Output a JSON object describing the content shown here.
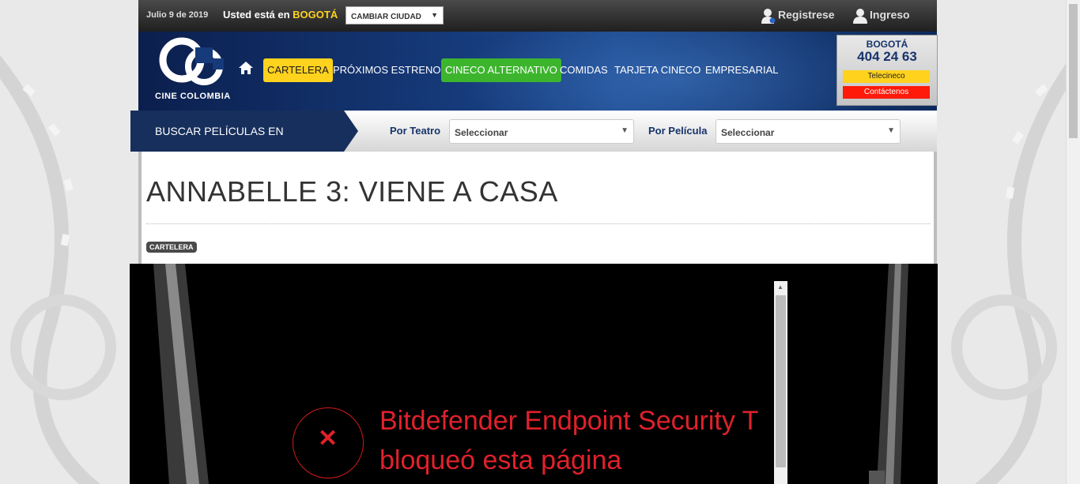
{
  "topbar": {
    "date": "Julio 9 de 2019",
    "location_prefix": "Usted está en",
    "city": "BOGOTÁ",
    "change_city": "CAMBIAR CIUDAD",
    "register": "Registrese",
    "login": "Ingreso"
  },
  "brand": {
    "name": "CINE COLOMBIA"
  },
  "menu": [
    {
      "label": "CARTELERA",
      "style": "yellow"
    },
    {
      "label": "PRÓXIMOS ESTRENOS",
      "style": "plain"
    },
    {
      "label": "CINECO ALTERNATIVO",
      "style": "green"
    },
    {
      "label": "COMIDAS",
      "style": "plain"
    },
    {
      "label": "TARJETA CINECO",
      "style": "plain"
    },
    {
      "label": "EMPRESARIAL",
      "style": "plain"
    }
  ],
  "contact": {
    "city": "BOGOTÁ",
    "phone": "404 24 63",
    "telecineco": "Telecineco",
    "contact_us": "Contáctenos"
  },
  "search": {
    "label": "BUSCAR PELÍCULAS EN CARTELERA",
    "by_theater": "Por Teatro",
    "theater_value": "Seleccionar",
    "by_movie": "Por Película",
    "movie_value": "Seleccionar"
  },
  "movie": {
    "title": "ANNABELLE 3: VIENE A CASA",
    "tag": "CARTELERA"
  },
  "blocked": {
    "line1": "Bitdefender Endpoint Security T",
    "line2": "bloqueó esta página"
  },
  "colors": {
    "yellow": "#ffd21e",
    "green": "#3cb52d",
    "navy": "#172f5c",
    "alert_red": "#e0212b"
  }
}
